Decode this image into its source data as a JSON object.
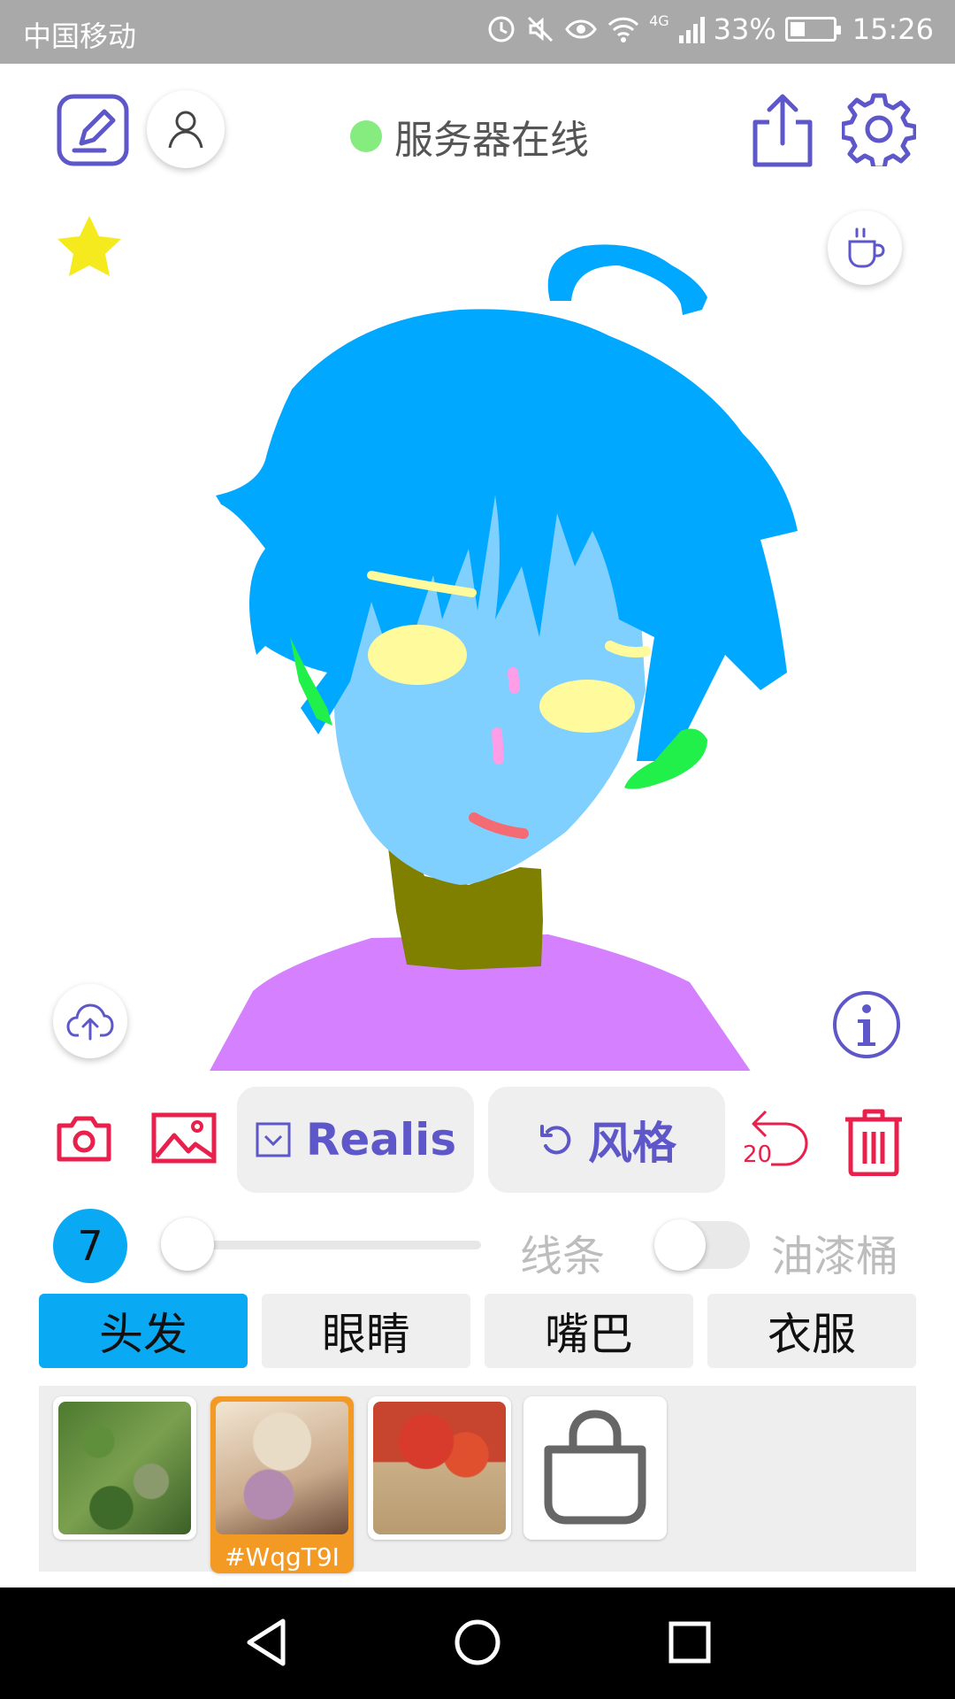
{
  "status_bar": {
    "carrier": "中国移动",
    "network_type": "4G",
    "battery": "33%",
    "time": "15:26"
  },
  "header": {
    "server_status_text": "服务器在线",
    "server_status_color": "#86ec80"
  },
  "actions": {
    "realis_label": "Realis",
    "style_label": "风格",
    "undo_count": "20"
  },
  "brush": {
    "size": "7",
    "line_label": "线条",
    "bucket_label": "油漆桶"
  },
  "tabs": [
    {
      "label": "头发",
      "active": true
    },
    {
      "label": "眼睛",
      "active": false
    },
    {
      "label": "嘴巴",
      "active": false
    },
    {
      "label": "衣服",
      "active": false
    }
  ],
  "textures": [
    {
      "label": ""
    },
    {
      "label": "#WqgT9I"
    },
    {
      "label": ""
    }
  ],
  "colors": {
    "accent": "#5e57c9",
    "danger": "#e8204b",
    "tab_active": "#0aa9f3",
    "hair": "#00a8ff",
    "skin": "#7fcfff",
    "neck": "#7f7f00",
    "shirt": "#d580ff"
  },
  "icons": {
    "sketch": "edit-square-icon",
    "user": "user-icon",
    "share": "share-icon",
    "settings": "gear-icon",
    "favorite": "star-icon",
    "tea": "cup-icon",
    "upload": "cloud-upload-icon",
    "info": "info-icon",
    "camera": "camera-icon",
    "gallery": "image-icon",
    "undo": "undo-icon",
    "delete": "trash-icon",
    "shop": "bag-icon"
  }
}
